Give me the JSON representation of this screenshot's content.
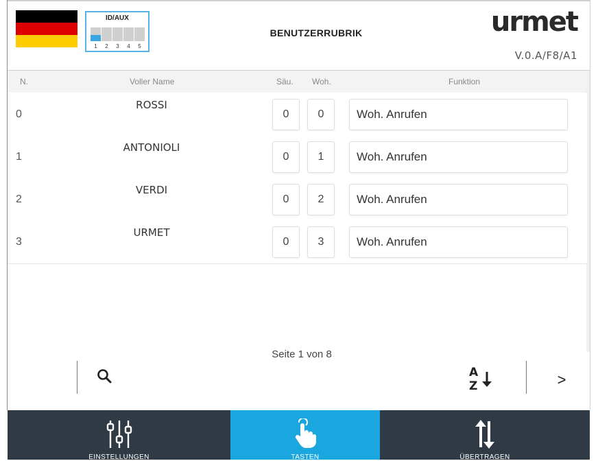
{
  "header": {
    "idaux_label": "ID/AUX",
    "dip_numbers": [
      "1",
      "2",
      "3",
      "4",
      "5"
    ],
    "dip_states": [
      true,
      false,
      false,
      false,
      false
    ],
    "title": "BENUTZERRUBRIK",
    "logo": "urmet",
    "version": "V.0.A/F8/A1",
    "flag_colors": [
      "#000000",
      "#dd0000",
      "#ffce00"
    ]
  },
  "table": {
    "columns": {
      "num": "N.",
      "name": "Voller Name",
      "column": "Säu.",
      "apartment": "Woh.",
      "function": "Funktion"
    },
    "rows": [
      {
        "num": "0",
        "name": "ROSSI",
        "column": "0",
        "apartment": "0",
        "function": "Woh. Anrufen"
      },
      {
        "num": "1",
        "name": "ANTONIOLI",
        "column": "0",
        "apartment": "1",
        "function": "Woh. Anrufen"
      },
      {
        "num": "2",
        "name": "VERDI",
        "column": "0",
        "apartment": "2",
        "function": "Woh. Anrufen"
      },
      {
        "num": "3",
        "name": "URMET",
        "column": "0",
        "apartment": "3",
        "function": "Woh. Anrufen"
      }
    ]
  },
  "pagination": {
    "page_info": "Seite 1 von 8",
    "next_label": ">"
  },
  "nav": {
    "settings": "EINSTELLUNGEN",
    "buttons": "TASTEN",
    "transfer": "ÜBERTRAGEN",
    "active_color": "#1aa6de",
    "bar_color": "#2f3a45"
  }
}
